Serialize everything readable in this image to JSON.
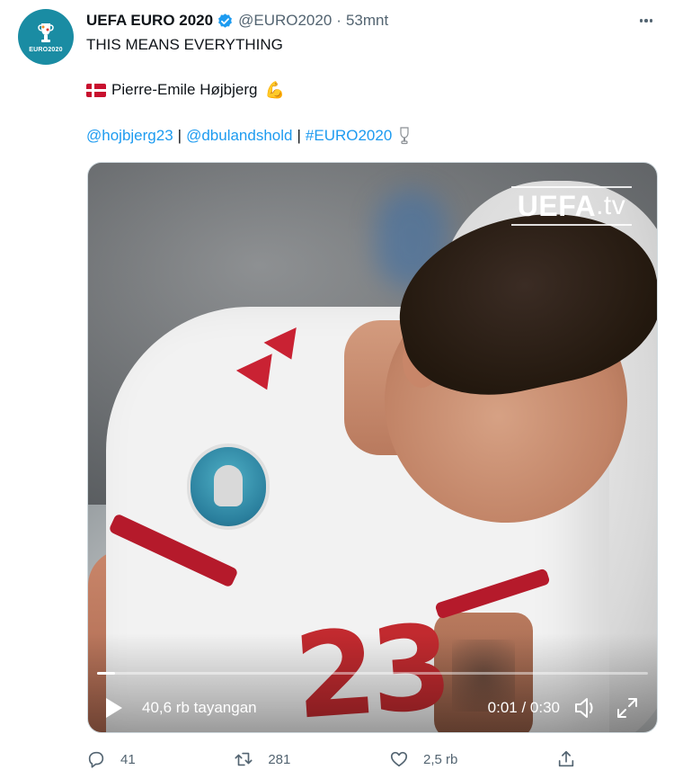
{
  "tweet": {
    "display_name": "UEFA EURO 2020",
    "handle": "@EURO2020",
    "separator": "·",
    "time": "53mnt",
    "avatar_text": "EURO2020",
    "line1": "THIS MEANS EVERYTHING",
    "line2_name": "Pierre-Emile Højbjerg",
    "line2_emoji": "💪",
    "links": [
      "@hojbjerg23",
      "@dbulandshold",
      "#EURO2020"
    ],
    "link_separator": "|"
  },
  "video": {
    "watermark_brand": "UEFA",
    "watermark_suffix": ".tv",
    "views": "40,6 rb tayangan",
    "timecode": "0:01 / 0:30",
    "progress": 0.033
  },
  "actions": {
    "replies": "41",
    "retweets": "281",
    "likes": "2,5 rb"
  },
  "colors": {
    "link": "#1d9bf0",
    "muted": "#536471",
    "verified": "#1d9bf0",
    "avatar_bg": "#1a8ca3"
  },
  "icons": [
    "verified-badge-icon",
    "more-dots-icon",
    "danish-flag-icon",
    "flexed-biceps-icon",
    "trophy-icon",
    "play-icon",
    "volume-icon",
    "fullscreen-icon",
    "reply-icon",
    "retweet-icon",
    "like-icon",
    "share-icon"
  ]
}
